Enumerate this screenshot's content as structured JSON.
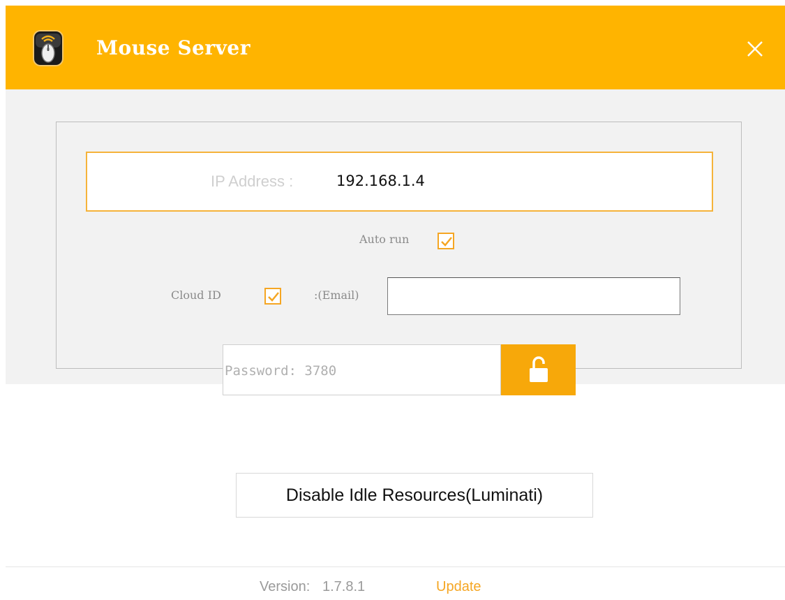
{
  "app": {
    "title": "Mouse Server",
    "accent_color": "#FFB400",
    "icon": "mouse-app-icon",
    "close_icon": "close-icon"
  },
  "ip": {
    "label": "IP Address :",
    "value": "192.168.1.4"
  },
  "auto_run": {
    "label": "Auto run",
    "checked": true
  },
  "cloud": {
    "label": "Cloud ID",
    "checked": true,
    "email_label": ":(Email)",
    "email_value": ""
  },
  "password": {
    "text": "Password: 3780",
    "lock_icon": "unlock-icon"
  },
  "actions": {
    "disable_idle": "Disable Idle Resources(Luminati)"
  },
  "footer": {
    "version_label": "Version:",
    "version_value": "1.7.8.1",
    "update_link": "Update",
    "update_color": "#F5A623"
  }
}
